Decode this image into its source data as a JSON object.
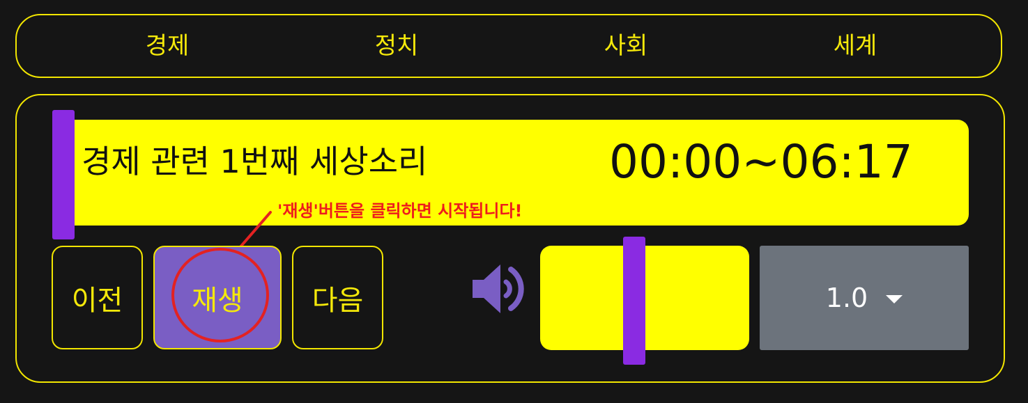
{
  "nav": {
    "items": [
      {
        "label": "경제"
      },
      {
        "label": "정치"
      },
      {
        "label": "사회"
      },
      {
        "label": "세계"
      }
    ]
  },
  "player": {
    "title": "경제 관련 1번째 세상소리",
    "time": "00:00~06:17",
    "progress": 0,
    "hint": "'재생'버튼을 클릭하면 시작됩니다!",
    "buttons": {
      "prev": "이전",
      "play": "재생",
      "next": "다음"
    },
    "volume_icon": "speaker-icon",
    "volume_level": 0.45,
    "speed": "1.0"
  },
  "colors": {
    "accent_yellow": "#ffff00",
    "handle_purple": "#8a2be2",
    "play_button": "#7a5ec4",
    "hint_red": "#ee1c1c",
    "speed_gray": "#6c737c"
  }
}
